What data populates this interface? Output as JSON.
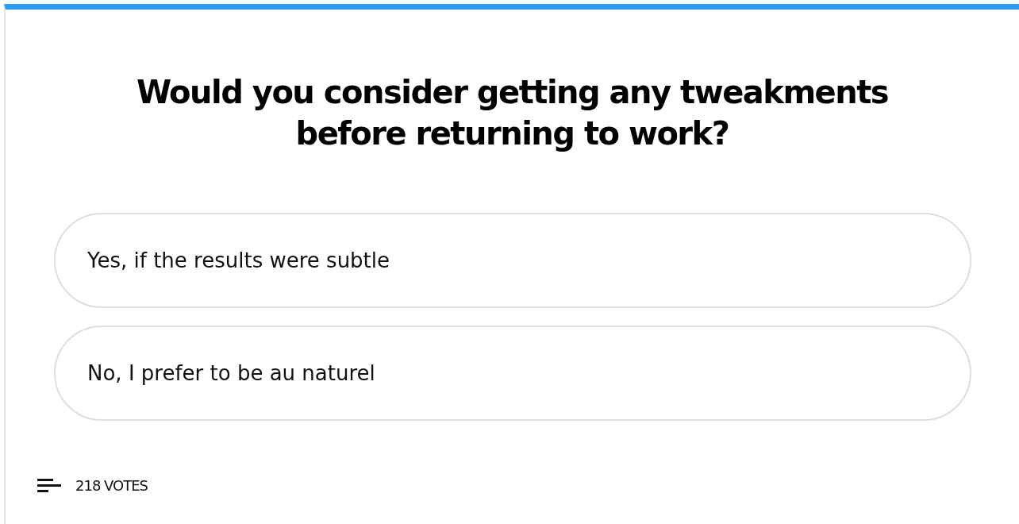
{
  "poll": {
    "question": "Would you consider getting any tweakments before returning to work?",
    "options": [
      {
        "label": "Yes, if the results were subtle"
      },
      {
        "label": "No, I prefer to be au naturel"
      }
    ],
    "votes": "218 VOTES"
  }
}
